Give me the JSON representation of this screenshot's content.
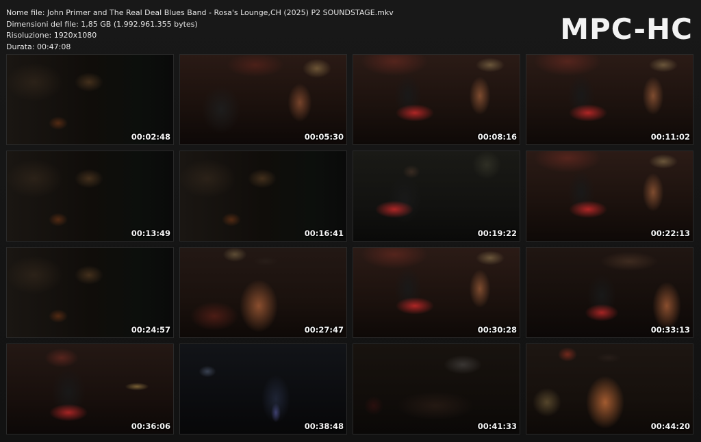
{
  "info": {
    "filename_line": "Nome file: John Primer and The Real Deal Blues Band - Rosa's Lounge,CH (2025) P2 SOUNDSTAGE.mkv",
    "filesize_line": "Dimensioni del file: 1,85 GB (1.992.961.355 bytes)",
    "resolution_line": "Risoluzione: 1920x1080",
    "duration_line": "Durata: 00:47:08"
  },
  "logo": "MPC-HC",
  "thumbnails": [
    {
      "timestamp": "00:02:48",
      "scene": "dark"
    },
    {
      "timestamp": "00:05:30",
      "scene": "stage"
    },
    {
      "timestamp": "00:08:16",
      "scene": "guitar"
    },
    {
      "timestamp": "00:11:02",
      "scene": "guitar"
    },
    {
      "timestamp": "00:13:49",
      "scene": "dark"
    },
    {
      "timestamp": "00:16:41",
      "scene": "dark"
    },
    {
      "timestamp": "00:19:22",
      "scene": "closeup"
    },
    {
      "timestamp": "00:22:13",
      "scene": "guitar"
    },
    {
      "timestamp": "00:24:57",
      "scene": "dark"
    },
    {
      "timestamp": "00:27:47",
      "scene": "harp"
    },
    {
      "timestamp": "00:30:28",
      "scene": "guitar"
    },
    {
      "timestamp": "00:33:13",
      "scene": "duo"
    },
    {
      "timestamp": "00:36:06",
      "scene": "drum"
    },
    {
      "timestamp": "00:38:48",
      "scene": "blue"
    },
    {
      "timestamp": "00:41:33",
      "scene": "crowd"
    },
    {
      "timestamp": "00:44:20",
      "scene": "final"
    }
  ]
}
